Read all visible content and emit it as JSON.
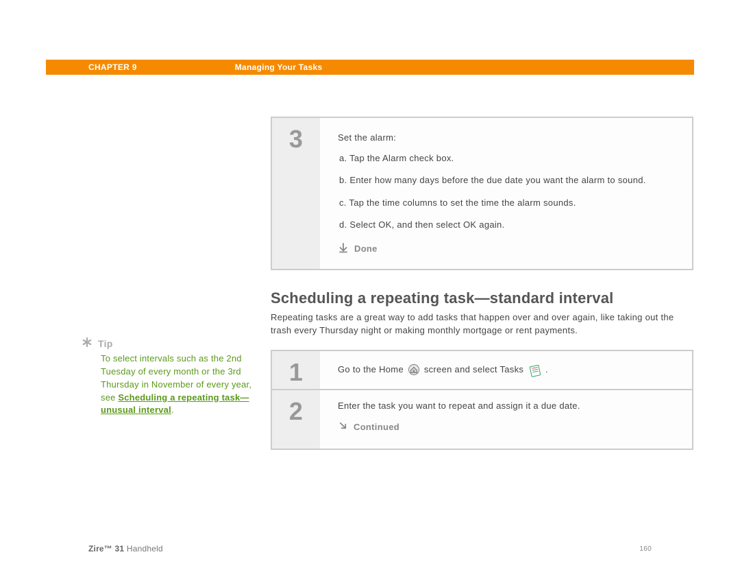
{
  "header": {
    "chapter": "CHAPTER 9",
    "title": "Managing Your Tasks"
  },
  "sidebar": {
    "tip_label": "Tip",
    "tip_text": "To select intervals such as the 2nd Tuesday of every month or the 3rd Thursday in November of every year, see ",
    "tip_link": "Scheduling a repeating task—unusual interval"
  },
  "step3": {
    "num": "3",
    "intro": "Set the alarm:",
    "a": "a.  Tap the Alarm check box.",
    "b": "b.  Enter how many days before the due date you want the alarm to sound.",
    "c": "c.  Tap the time columns to set the time the alarm sounds.",
    "d": "d.  Select OK, and then select OK again.",
    "done": "Done"
  },
  "section": {
    "heading": "Scheduling a repeating task—standard interval",
    "para": "Repeating tasks are a great way to add tasks that happen over and over again, like taking out the trash every Thursday night or making monthly mortgage or rent payments."
  },
  "step1": {
    "num": "1",
    "before": "Go to the Home ",
    "mid": " screen and select Tasks ",
    "after": " ."
  },
  "step2": {
    "num": "2",
    "text": "Enter the task you want to repeat and assign it a due date.",
    "continued": "Continued"
  },
  "footer": {
    "brand_bold": "Zire™ 31",
    "brand_rest": " Handheld",
    "page": "160"
  }
}
